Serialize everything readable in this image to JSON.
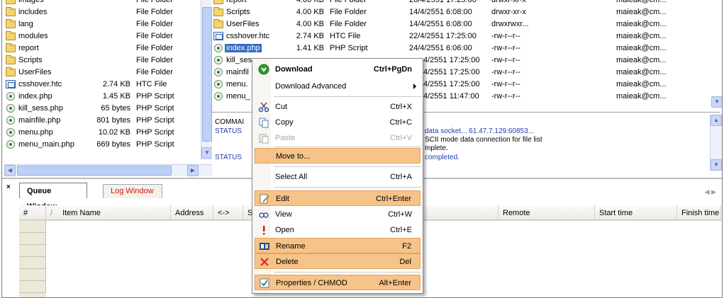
{
  "local_pane": {
    "rows": [
      {
        "name": "images",
        "size": "",
        "type": "File Folder",
        "icon": "folder-icon"
      },
      {
        "name": "includes",
        "size": "",
        "type": "File Folder",
        "icon": "folder-icon"
      },
      {
        "name": "lang",
        "size": "",
        "type": "File Folder",
        "icon": "folder-icon"
      },
      {
        "name": "modules",
        "size": "",
        "type": "File Folder",
        "icon": "folder-icon"
      },
      {
        "name": "report",
        "size": "",
        "type": "File Folder",
        "icon": "folder-icon"
      },
      {
        "name": "Scripts",
        "size": "",
        "type": "File Folder",
        "icon": "folder-icon"
      },
      {
        "name": "UserFiles",
        "size": "",
        "type": "File Folder",
        "icon": "folder-icon"
      },
      {
        "name": "csshover.htc",
        "size": "2.74 KB",
        "type": "HTC File",
        "icon": "htc-file-icon"
      },
      {
        "name": "index.php",
        "size": "1.45 KB",
        "type": "PHP Script",
        "icon": "php-file-icon"
      },
      {
        "name": "kill_sess.php",
        "size": "65 bytes",
        "type": "PHP Script",
        "icon": "php-file-icon"
      },
      {
        "name": "mainfile.php",
        "size": "801 bytes",
        "type": "PHP Script",
        "icon": "php-file-icon"
      },
      {
        "name": "menu.php",
        "size": "10.02 KB",
        "type": "PHP Script",
        "icon": "php-file-icon"
      },
      {
        "name": "menu_main.php",
        "size": "669 bytes",
        "type": "PHP Script",
        "icon": "php-file-icon"
      }
    ]
  },
  "remote_pane": {
    "rows": [
      {
        "name": "report",
        "size": "4.00 KB",
        "type": "File Folder",
        "date": "26/4/2551 17:25:00",
        "attr": "drwxr-xr-x",
        "owner": "maieak@cm...",
        "icon": "folder-icon"
      },
      {
        "name": "Scripts",
        "size": "4.00 KB",
        "type": "File Folder",
        "date": "14/4/2551 6:08:00",
        "attr": "drwxr-xr-x",
        "owner": "maieak@cm...",
        "icon": "folder-icon"
      },
      {
        "name": "UserFiles",
        "size": "4.00 KB",
        "type": "File Folder",
        "date": "14/4/2551 6:08:00",
        "attr": "drwxrwxr...",
        "owner": "maieak@cm...",
        "icon": "folder-icon"
      },
      {
        "name": "csshover.htc",
        "size": "2.74 KB",
        "type": "HTC File",
        "date": "22/4/2551 17:25:00",
        "attr": "-rw-r--r--",
        "owner": "maieak@cm...",
        "icon": "htc-file-icon"
      },
      {
        "name": "index.php",
        "size": "1.41 KB",
        "type": "PHP Script",
        "date": "24/4/2551 6:06:00",
        "attr": "-rw-r--r--",
        "owner": "maieak@cm...",
        "icon": "php-file-icon"
      },
      {
        "name": "kill_ses",
        "size": "",
        "type": "",
        "date": "4/2551 17:25:00",
        "attr": "-rw-r--r--",
        "owner": "maieak@cm...",
        "icon": "php-file-icon"
      },
      {
        "name": "mainfil",
        "size": "",
        "type": "",
        "date": "4/2551 17:25:00",
        "attr": "-rw-r--r--",
        "owner": "maieak@cm...",
        "icon": "php-file-icon"
      },
      {
        "name": "menu.",
        "size": "",
        "type": "",
        "date": "4/2551 17:25:00",
        "attr": "-rw-r--r--",
        "owner": "maieak@cm...",
        "icon": "php-file-icon"
      },
      {
        "name": "menu_",
        "size": "",
        "type": "",
        "date": "4/2551 11:47:00",
        "attr": "-rw-r--r--",
        "owner": "maieak@cm...",
        "icon": "php-file-icon"
      }
    ]
  },
  "log": {
    "lines": [
      {
        "label": "COMMAI",
        "text": ""
      },
      {
        "label": "STATUS",
        "text": "data socket... 61.47.7.129:60853..."
      },
      {
        "label": "",
        "text": "SCII mode data connection for file list"
      },
      {
        "label": "",
        "text": "mplete."
      },
      {
        "label": "STATUS",
        "text": "completed."
      }
    ]
  },
  "queue": {
    "tabs": [
      "Queue Window",
      "Log Window"
    ],
    "columns": [
      "#",
      "Item Name",
      "Address",
      "<->",
      "S",
      "Remote",
      "Start time",
      "Finish time"
    ]
  },
  "context_menu": {
    "items": [
      {
        "label": "Download",
        "key": "Ctrl+PgDn",
        "icon": "download-icon"
      },
      {
        "label": "Download Advanced",
        "key": "",
        "icon": "submenu-arrow-icon"
      },
      {
        "label": "Cut",
        "key": "Ctrl+X",
        "icon": "scissors-icon"
      },
      {
        "label": "Copy",
        "key": "Ctrl+C",
        "icon": "copy-icon"
      },
      {
        "label": "Paste",
        "key": "Ctrl+V",
        "icon": "paste-icon"
      },
      {
        "label": "Move to...",
        "key": "",
        "icon": ""
      },
      {
        "label": "Select All",
        "key": "Ctrl+A",
        "icon": ""
      },
      {
        "label": "Edit",
        "key": "Ctrl+Enter",
        "icon": "edit-icon"
      },
      {
        "label": "View",
        "key": "Ctrl+W",
        "icon": "view-icon"
      },
      {
        "label": "Open",
        "key": "Ctrl+E",
        "icon": "open-icon"
      },
      {
        "label": "Rename",
        "key": "F2",
        "icon": "rename-icon"
      },
      {
        "label": "Delete",
        "key": "Del",
        "icon": "delete-icon"
      },
      {
        "label": "Properties / CHMOD",
        "key": "Alt+Enter",
        "icon": "properties-icon"
      }
    ]
  },
  "colors": {
    "menu_highlight": "#f6c388",
    "selection": "#316ac5",
    "log_blue": "#1c3ca8",
    "log_tab_text": "#c41c1c"
  }
}
